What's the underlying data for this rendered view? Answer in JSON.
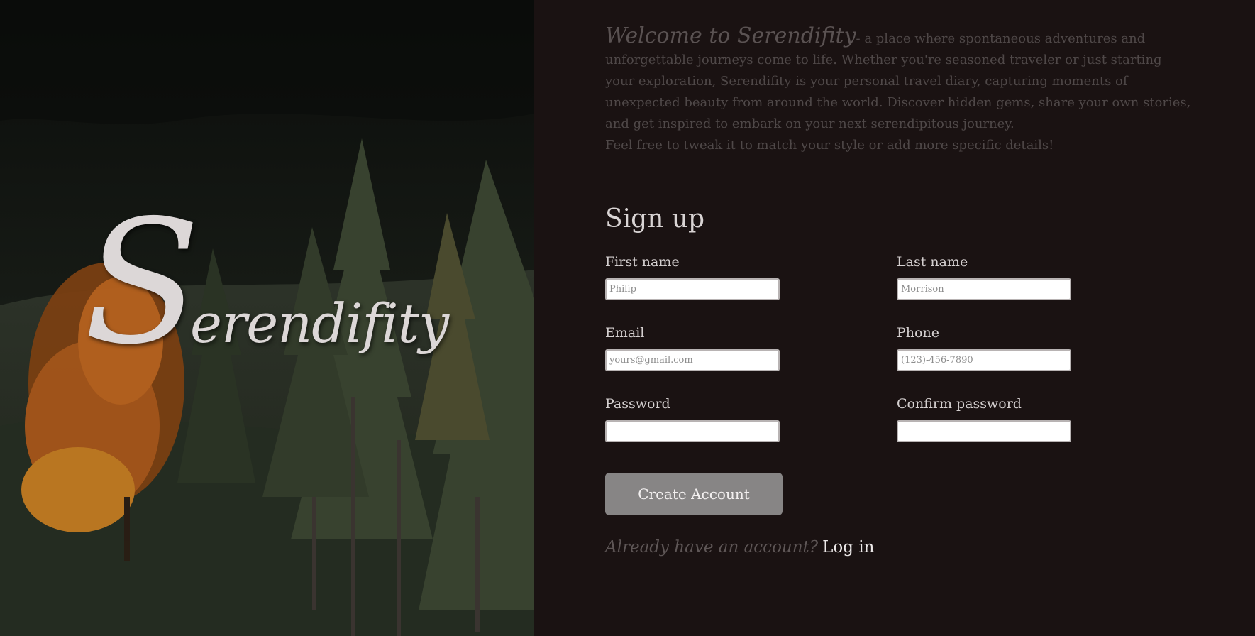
{
  "hero": {
    "logo_initial": "S",
    "logo_rest": "erendifity"
  },
  "intro": {
    "welcome": "Welcome to Serendifity",
    "description": "- a place where spontaneous adventures and unforgettable journeys come to life. Whether you're seasoned traveler or just starting your exploration, Serendifity is your personal travel diary, capturing moments of unexpected beauty from around the world. Discover hidden gems, share your own stories, and get inspired to embark on your next serendipitous journey.",
    "note": "Feel free to tweak it to match your style or add more specific details!"
  },
  "form": {
    "title": "Sign up",
    "first_name": {
      "label": "First name",
      "placeholder": "Philip",
      "value": ""
    },
    "last_name": {
      "label": "Last name",
      "placeholder": "Morrison",
      "value": ""
    },
    "email": {
      "label": "Email",
      "placeholder": "yours@gmail.com",
      "value": ""
    },
    "phone": {
      "label": "Phone",
      "placeholder": "(123)-456-7890",
      "value": ""
    },
    "password": {
      "label": "Password",
      "placeholder": "",
      "value": ""
    },
    "confirm_password": {
      "label": "Confirm password",
      "placeholder": "",
      "value": ""
    },
    "submit_label": "Create Account"
  },
  "login": {
    "question": "Already have an account?",
    "link_label": "Log in"
  },
  "colors": {
    "panel_background": "#1a1212",
    "button_background": "#878585",
    "logo_text": "#dcd7d7",
    "intro_text": "#4f4848"
  }
}
